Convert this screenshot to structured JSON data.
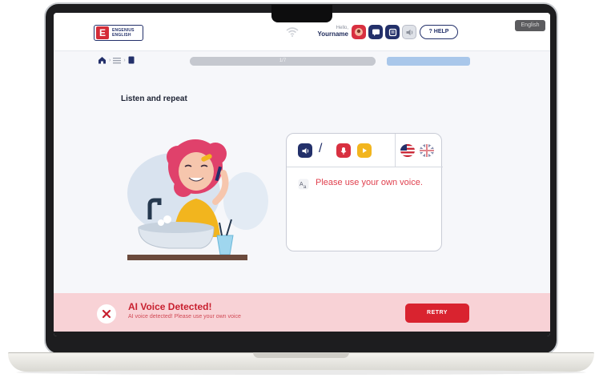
{
  "header": {
    "logo_line1": "ENGENIUS",
    "logo_line2": "ENGLISH",
    "greeting": "Hello,",
    "username": "Yourname",
    "help_label": "? HELP",
    "side_tab": "English"
  },
  "nav": {
    "progress_label": "1/7",
    "progress_fraction": 1.0
  },
  "exercise": {
    "instruction": "Listen and repeat",
    "message": "Please use your own voice.",
    "slash": "/"
  },
  "alert": {
    "title": "AI Voice Detected!",
    "subtitle": "AI voice detected! Please use your own voice",
    "retry_label": "RETRY"
  },
  "colors": {
    "brand_navy": "#23306a",
    "brand_red": "#d83040",
    "alert_bg": "#f8d2d6",
    "accent_yellow": "#f2b51e",
    "message_red": "#e0404e"
  },
  "icons": [
    "wifi-icon",
    "avatar-icon",
    "chat-icon",
    "book-icon",
    "volume-icon",
    "home-icon",
    "menu-icon",
    "lesson-icon",
    "speaker-icon",
    "mic-icon",
    "play-icon",
    "us-flag-icon",
    "uk-flag-icon",
    "translate-icon",
    "close-icon"
  ]
}
